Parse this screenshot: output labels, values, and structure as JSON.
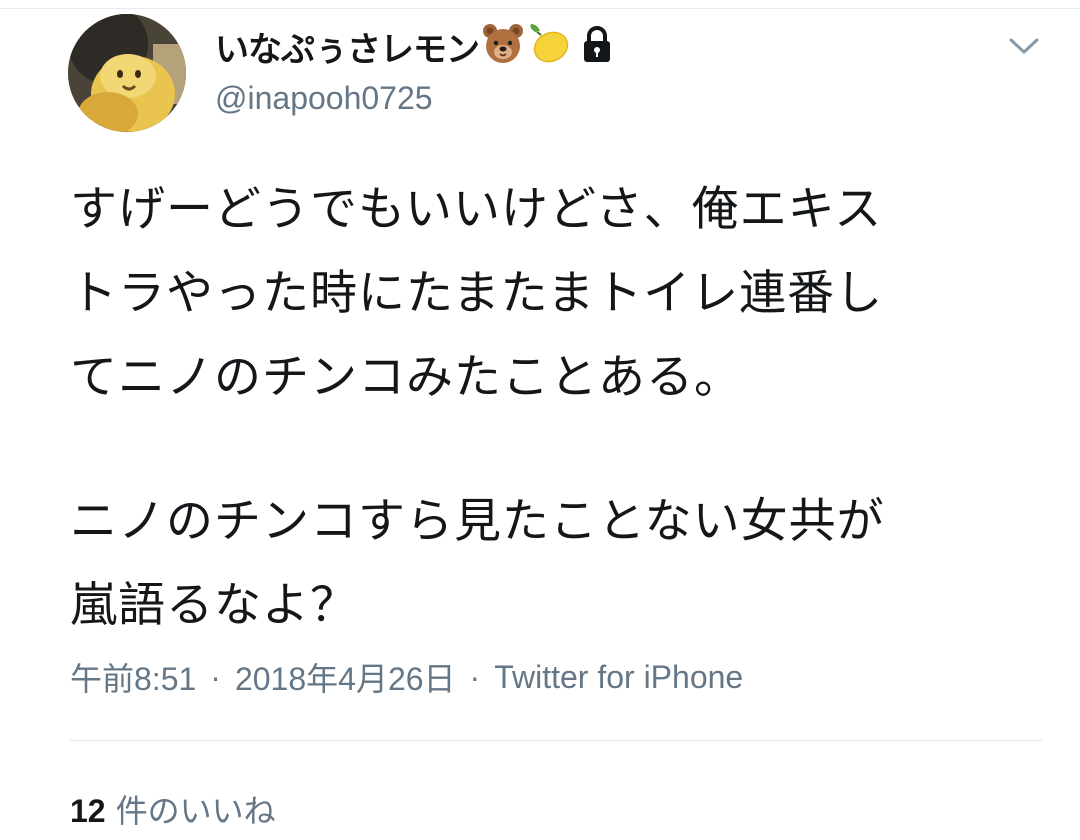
{
  "tweet": {
    "author": {
      "display_name": "いなぷぅさレモン",
      "name_icons": [
        "bear-face-icon",
        "lemon-icon",
        "lock-icon"
      ],
      "handle": "@inapooh0725"
    },
    "body_lines": [
      "すげーどうでもいいけどさ、俺エキス",
      "トラやった時にたまたまトイレ連番し",
      "てニノのチンコみたことある。",
      "",
      "ニノのチンコすら見たことない女共が",
      "嵐語るなよ？"
    ],
    "time": "午前8:51",
    "separator": "·",
    "date": "2018年4月26日",
    "source": "Twitter for iPhone",
    "likes_count": "12",
    "likes_label": "件のいいね"
  },
  "colors": {
    "text": "#14171a",
    "secondary": "#657786",
    "divider": "#e1e8ed"
  }
}
